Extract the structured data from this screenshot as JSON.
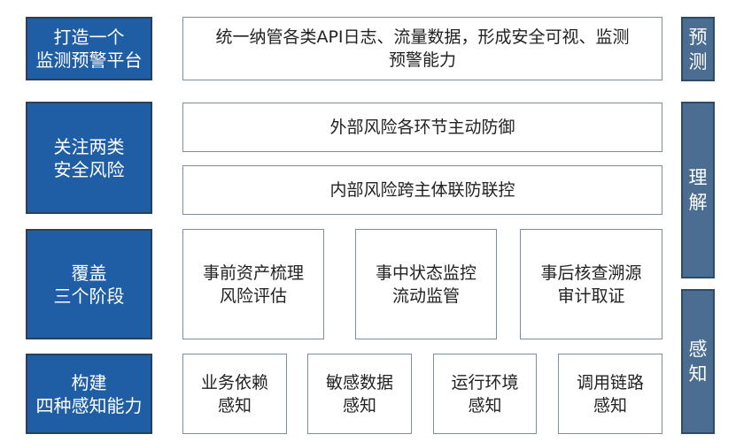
{
  "rows": {
    "platform": {
      "label": "打造一个\n监测预警平台",
      "content": "统一纳管各类API日志、流量数据，形成安全可视、监测\n预警能力"
    },
    "risks": {
      "label": "关注两类\n安全风险",
      "items": [
        "外部风险各环节主动防御",
        "内部风险跨主体联防联控"
      ]
    },
    "stages": {
      "label": "覆盖\n三个阶段",
      "items": [
        "事前资产梳理\n风险评估",
        "事中状态监控\n流动监管",
        "事后核查溯源\n审计取证"
      ]
    },
    "capabilities": {
      "label": "构建\n四种感知能力",
      "items": [
        "业务依赖\n感知",
        "敏感数据\n感知",
        "运行环境\n感知",
        "调用链路\n感知"
      ]
    }
  },
  "side": {
    "predict": "预\n测",
    "understand": "理\n解",
    "perceive": "感\n知"
  },
  "colors": {
    "left_fill": "#1f5ea4",
    "side_fill": "#4a6d91",
    "content_border": "#7d8da3"
  }
}
